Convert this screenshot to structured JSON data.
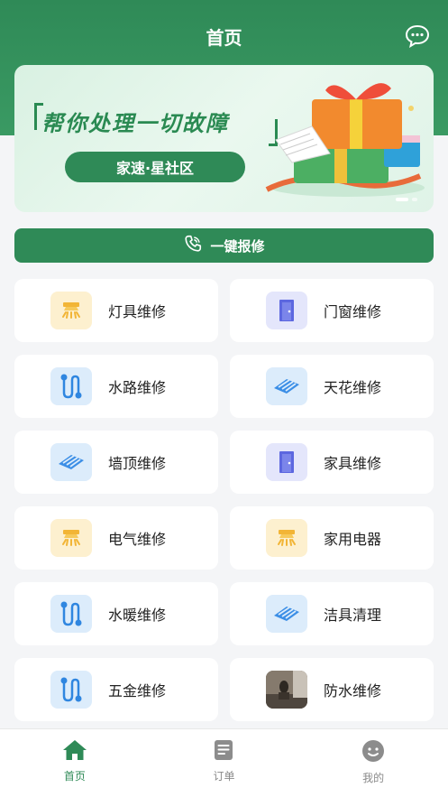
{
  "header": {
    "title": "首页",
    "message_icon": "chat-bubble-icon"
  },
  "banner": {
    "headline": "帮你处理一切故障",
    "pill": "家速·星社区",
    "accent_color": "#2f8a57"
  },
  "repair_button": {
    "label": "一键报修",
    "icon": "phone-icon"
  },
  "services": [
    {
      "label": "灯具维修",
      "icon": "lamp-icon",
      "tone": "yellow"
    },
    {
      "label": "门窗维修",
      "icon": "door-icon",
      "tone": "purple"
    },
    {
      "label": "水路维修",
      "icon": "pipe-icon",
      "tone": "blue"
    },
    {
      "label": "天花维修",
      "icon": "ceiling-icon",
      "tone": "blue"
    },
    {
      "label": "墙顶维修",
      "icon": "ceiling-icon",
      "tone": "blue"
    },
    {
      "label": "家具维修",
      "icon": "door-icon",
      "tone": "purple"
    },
    {
      "label": "电气维修",
      "icon": "lamp-icon",
      "tone": "yellow"
    },
    {
      "label": "家用电器",
      "icon": "lamp-icon",
      "tone": "yellow"
    },
    {
      "label": "水暖维修",
      "icon": "pipe-icon",
      "tone": "blue"
    },
    {
      "label": "洁具清理",
      "icon": "ceiling-icon",
      "tone": "blue"
    },
    {
      "label": "五金维修",
      "icon": "pipe-icon",
      "tone": "blue"
    },
    {
      "label": "防水维修",
      "icon": "photo-thumbnail",
      "tone": "photo"
    }
  ],
  "tabbar": {
    "tabs": [
      {
        "label": "首页",
        "icon": "home-icon",
        "active": true
      },
      {
        "label": "订单",
        "icon": "order-icon",
        "active": false
      },
      {
        "label": "我的",
        "icon": "profile-icon",
        "active": false
      }
    ]
  }
}
